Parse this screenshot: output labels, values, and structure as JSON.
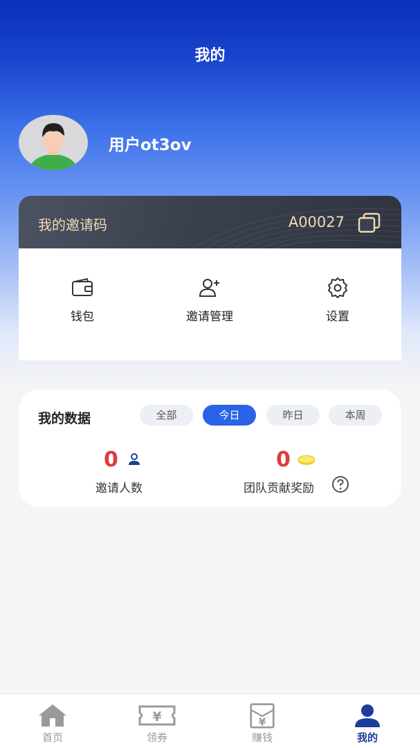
{
  "header": {
    "title": "我的"
  },
  "profile": {
    "username": "用户ot3ov"
  },
  "invite": {
    "label": "我的邀请码",
    "code": "A00027"
  },
  "menu": [
    {
      "label": "钱包",
      "icon": "wallet-icon"
    },
    {
      "label": "邀请管理",
      "icon": "add-user-icon"
    },
    {
      "label": "设置",
      "icon": "gear-icon"
    }
  ],
  "data_section": {
    "title": "我的数据",
    "filters": [
      "全部",
      "今日",
      "昨日",
      "本周"
    ],
    "active_filter": "今日",
    "invite_count": {
      "value": "0",
      "label": "邀请人数",
      "icon": "person-icon"
    },
    "team_reward": {
      "value": "0",
      "label": "团队贡献奖励",
      "icon": "coin-icon",
      "help_icon": "question-icon"
    }
  },
  "nav": [
    {
      "label": "首页",
      "icon": "home-icon"
    },
    {
      "label": "领券",
      "icon": "coupon-icon"
    },
    {
      "label": "赚钱",
      "icon": "money-bag-icon"
    },
    {
      "label": "我的",
      "icon": "user-icon",
      "active": true
    }
  ],
  "colors": {
    "accent": "#2b63e8",
    "stat": "#e03a3a",
    "gold": "#f1d9b8",
    "nav_active": "#1d3d9c"
  }
}
